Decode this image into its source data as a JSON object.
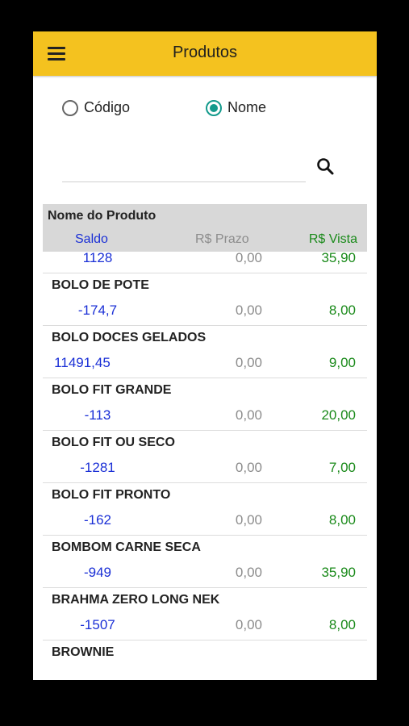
{
  "app": {
    "title": "Produtos",
    "accent_color": "#F4C21F"
  },
  "search_mode": {
    "options": [
      {
        "label": "Código",
        "selected": false
      },
      {
        "label": "Nome",
        "selected": true
      }
    ]
  },
  "search": {
    "value": "",
    "placeholder": ""
  },
  "table": {
    "header": {
      "name_label": "Nome do Produto",
      "saldo_label": "Saldo",
      "prazo_label": "R$ Prazo",
      "vista_label": "R$ Vista"
    },
    "rows": [
      {
        "name": "",
        "saldo": "1128",
        "prazo": "0,00",
        "vista": "35,90"
      },
      {
        "name": "BOLO DE POTE",
        "saldo": "-174,7",
        "prazo": "0,00",
        "vista": "8,00"
      },
      {
        "name": "BOLO DOCES GELADOS",
        "saldo": "11491,45",
        "prazo": "0,00",
        "vista": "9,00"
      },
      {
        "name": "BOLO FIT GRANDE",
        "saldo": "-113",
        "prazo": "0,00",
        "vista": "20,00"
      },
      {
        "name": "BOLO FIT OU SECO",
        "saldo": "-1281",
        "prazo": "0,00",
        "vista": "7,00"
      },
      {
        "name": "BOLO FIT PRONTO",
        "saldo": "-162",
        "prazo": "0,00",
        "vista": "8,00"
      },
      {
        "name": "BOMBOM CARNE SECA",
        "saldo": "-949",
        "prazo": "0,00",
        "vista": "35,90"
      },
      {
        "name": "BRAHMA ZERO LONG NEK",
        "saldo": "-1507",
        "prazo": "0,00",
        "vista": "8,00"
      },
      {
        "name": "BROWNIE",
        "saldo": "",
        "prazo": "",
        "vista": ""
      }
    ]
  }
}
